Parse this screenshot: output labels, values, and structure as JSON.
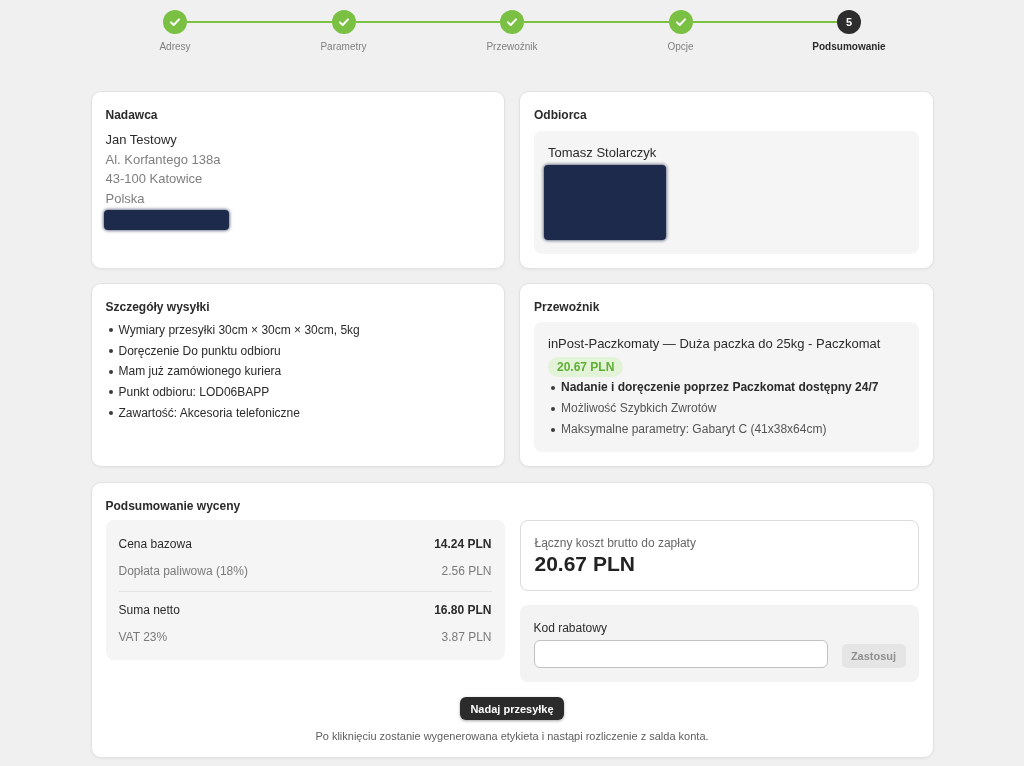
{
  "stepper": {
    "steps": [
      {
        "label": "Adresy",
        "done": true,
        "current": false
      },
      {
        "label": "Parametry",
        "done": true,
        "current": false
      },
      {
        "label": "Przewoźnik",
        "done": true,
        "current": false
      },
      {
        "label": "Opcje",
        "done": true,
        "current": false
      },
      {
        "label": "Podsumowanie",
        "done": false,
        "current": true,
        "number": "5"
      }
    ]
  },
  "sender": {
    "title": "Nadawca",
    "name": "Jan Testowy",
    "address_lines": [
      "Al. Korfantego 138a",
      "43-100 Katowice",
      "Polska"
    ],
    "redacted": true
  },
  "recipient": {
    "title": "Odbiorca",
    "name": "Tomasz Stolarczyk",
    "redacted": true
  },
  "shipment_details": {
    "title": "Szczegóły wysyłki",
    "items": [
      "Wymiary przesyłki 30cm × 30cm × 30cm, 5kg",
      "Doręczenie Do punktu odbioru",
      "Mam już zamówionego kuriera",
      "Punkt odbioru: LOD06BAPP",
      "Zawartość: Akcesoria telefoniczne"
    ]
  },
  "carrier": {
    "title": "Przewoźnik",
    "service": "inPost-Paczkomaty — Duża paczka do 25kg - Paczkomat",
    "price": "20.67 PLN",
    "features": [
      {
        "text": "Nadanie i doręczenie poprzez Paczkomat dostępny 24/7",
        "emphasized": true
      },
      {
        "text": "Możliwość Szybkich Zwrotów",
        "emphasized": false
      },
      {
        "text": "Maksymalne parametry: Gabaryt C (41x38x64cm)",
        "emphasized": false
      }
    ]
  },
  "quote_summary": {
    "title": "Podsumowanie wyceny",
    "groups": [
      {
        "rows": [
          {
            "label": "Cena bazowa",
            "value": "14.24 PLN",
            "kind": "main"
          },
          {
            "label": "Dopłata paliwowa (18%)",
            "value": "2.56 PLN",
            "kind": "sub"
          }
        ]
      },
      {
        "rows": [
          {
            "label": "Suma netto",
            "value": "16.80 PLN",
            "kind": "main"
          },
          {
            "label": "VAT 23%",
            "value": "3.87 PLN",
            "kind": "sub"
          }
        ]
      }
    ],
    "total": {
      "label": "Łączny koszt brutto do zapłaty",
      "amount": "20.67 PLN"
    },
    "discount": {
      "label": "Kod rabatowy",
      "apply_button": {
        "label": "Zastosuj",
        "disabled": true
      }
    },
    "submit_button": {
      "label": "Nadaj przesyłkę"
    },
    "note": "Po kliknięciu zostanie wygenerowana etykieta i nastąpi rozliczenie z salda konta."
  }
}
